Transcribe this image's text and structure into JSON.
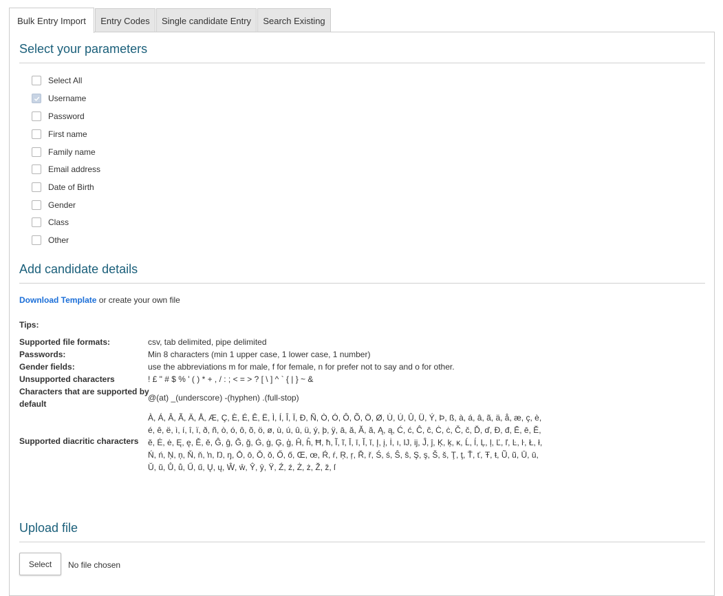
{
  "tabs": [
    {
      "label": "Bulk Entry Import",
      "active": true
    },
    {
      "label": "Entry Codes",
      "active": false
    },
    {
      "label": "Single candidate Entry",
      "active": false
    },
    {
      "label": "Search Existing",
      "active": false
    }
  ],
  "parameters": {
    "title": "Select your parameters",
    "items": [
      {
        "label": "Select All",
        "checked": false
      },
      {
        "label": "Username",
        "checked": true
      },
      {
        "label": "Password",
        "checked": false
      },
      {
        "label": "First name",
        "checked": false
      },
      {
        "label": "Family name",
        "checked": false
      },
      {
        "label": "Email address",
        "checked": false
      },
      {
        "label": "Date of Birth",
        "checked": false
      },
      {
        "label": "Gender",
        "checked": false
      },
      {
        "label": "Class",
        "checked": false
      },
      {
        "label": "Other",
        "checked": false
      }
    ]
  },
  "candidate": {
    "title": "Add candidate details",
    "download_link": "Download Template",
    "download_suffix": " or create your own file",
    "tips_title": "Tips:",
    "tips": [
      {
        "label": "Supported file formats:",
        "value": "csv, tab delimited, pipe delimited"
      },
      {
        "label": "Passwords:",
        "value": "Min 8 characters (min 1 upper case, 1 lower case, 1 number)"
      },
      {
        "label": "Gender fields:",
        "value": "use the abbreviations m for male, f for female, n for prefer not to say and o for other."
      },
      {
        "label": "Unsupported characters",
        "value": "! £ \" # $ % ' ( ) * + , / : ; < = > ? [ \\ ] ^ ` { | } ~ &"
      },
      {
        "label_line1": "Characters that are supported by",
        "label_line2": "default",
        "value": "@(at) _(underscore) -(hyphen) .(full-stop)"
      },
      {
        "label": "Supported diacritic characters",
        "value": "À, Á, Â, Ã, Ä, Å, Æ, Ç, È, É, Ê, Ë, Ì, Í, Î, Ï, Ð, Ñ, Ò, Ó, Ô, Õ, Ö, Ø, Ù, Ú, Û, Ü, Ý, Þ, ß, à, á, â, ã, ä, å, æ, ç, è, é, ê, ë, ì, í, î, ï, ð, ñ, ò, ó, ô, õ, ö, ø, ù, ú, û, ü, ý, þ, ÿ, ā, ă, Ă, ă, Ą, ą, Ć, ć, Ĉ, ĉ, Ċ, ċ, Č, č, Ď, ď, Đ, đ, Ē, ē, Ĕ, ĕ, Ė, ė, Ę, ę, Ě, ě, Ĝ, ĝ, Ğ, ğ, Ġ, ġ, Ģ, ģ, Ĥ, ĥ, Ħ, ħ, Ĩ, ĩ, Ī, ī, Ĭ, ĭ, Į, į, İ, ı, Ĳ, ĳ, Ĵ, ĵ, Ķ, ķ, ĸ, Ĺ, ĺ, Ļ, ļ, Ľ, ľ, Ŀ, ŀ, Ł, ł, Ń, ń, Ņ, ņ, Ň, ň, ŉ, Ŋ, ŋ, Ō, ō, Ŏ, ŏ, Ő, ő, Œ, œ, Ŕ, ŕ, Ŗ, ŗ, Ř, ř, Ś, ś, Ŝ, ŝ, Ş, ş, Š, š, Ţ, ţ, Ť, ť, Ŧ, ŧ, Ũ, ũ, Ū, ū, Ŭ, ŭ, Ů, ů, Ű, ű, Ų, ų, Ŵ, ŵ, Ŷ, ŷ, Ÿ, Ź, ź, Ż, ż, Ž, ž, ſ"
      }
    ]
  },
  "upload": {
    "title": "Upload file",
    "select_label": "Select",
    "status": "No file chosen"
  },
  "icons": {
    "checkmark": "checkmark-icon"
  },
  "colors": {
    "heading": "#1a5f7a",
    "link": "#1c6fd8",
    "checked_box": "#c8d4e4"
  }
}
